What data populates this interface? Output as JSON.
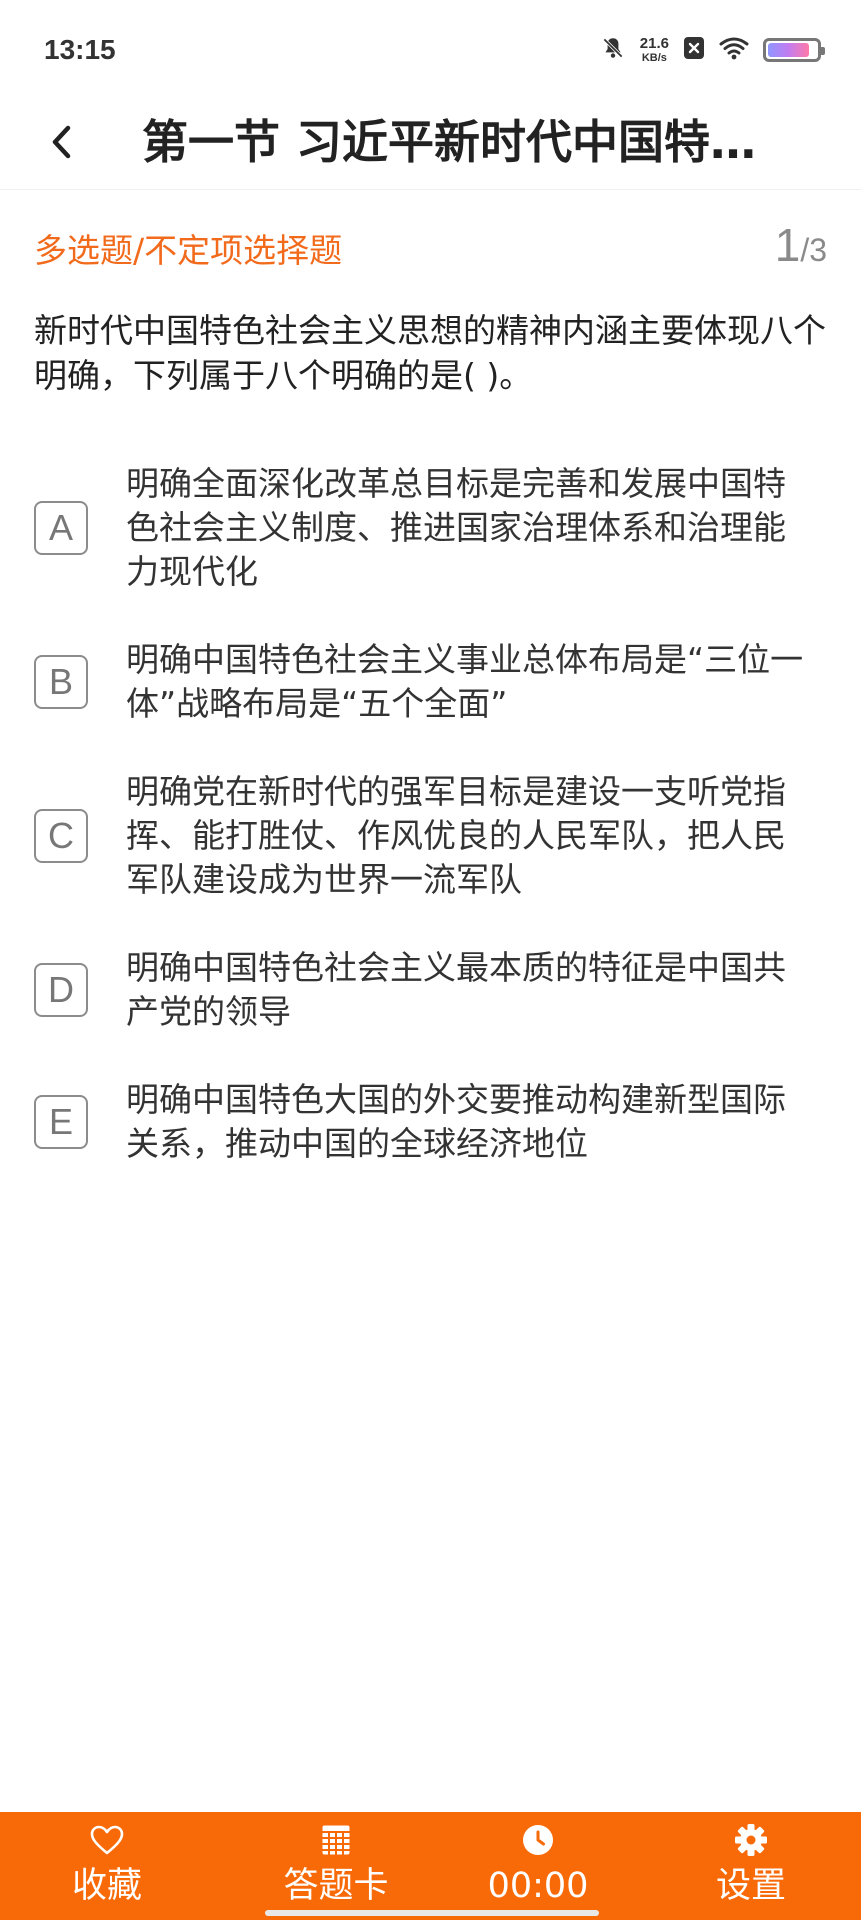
{
  "status_bar": {
    "time": "13:15",
    "net_speed_value": "21.6",
    "net_speed_unit": "KB/s",
    "battery_level": 0.85
  },
  "nav": {
    "title": "第一节 习近平新时代中国特…"
  },
  "question": {
    "type_label": "多选题/不定项选择题",
    "current": "1",
    "separator": "/",
    "total": "3",
    "stem": "新时代中国特色社会主义思想的精神内涵主要体现八个明确，下列属于八个明确的是( )。",
    "options": [
      {
        "letter": "A",
        "text": "明确全面深化改革总目标是完善和发展中国特色社会主义制度、推进国家治理体系和治理能力现代化"
      },
      {
        "letter": "B",
        "text": "明确中国特色社会主义事业总体布局是“三位一体”战略布局是“五个全面”"
      },
      {
        "letter": "C",
        "text": "明确党在新时代的强军目标是建设一支听党指挥、能打胜仗、作风优良的人民军队，把人民军队建设成为世界一流军队"
      },
      {
        "letter": "D",
        "text": "明确中国特色社会主义最本质的特征是中国共产党的领导"
      },
      {
        "letter": "E",
        "text": "明确中国特色大国的外交要推动构建新型国际关系，推动中国的全球经济地位"
      }
    ]
  },
  "bottom_bar": {
    "favorite_label": "收藏",
    "answer_card_label": "答题卡",
    "timer_value": "00:00",
    "settings_label": "设置"
  },
  "colors": {
    "accent": "#f86a08",
    "question_type": "#f26b1d"
  }
}
